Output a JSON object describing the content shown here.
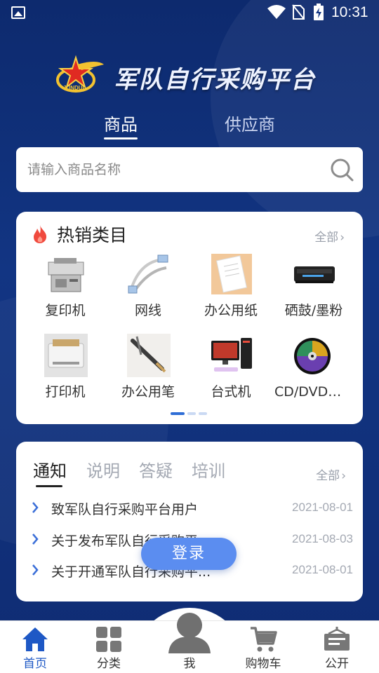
{
  "status_bar": {
    "time": "10:31"
  },
  "header": {
    "app_title": "军队自行采购平台",
    "emblem_text": "JUNDUI"
  },
  "top_tabs": [
    {
      "label": "商品",
      "active": true
    },
    {
      "label": "供应商",
      "active": false
    }
  ],
  "search": {
    "placeholder": "请输入商品名称",
    "value": ""
  },
  "hot_categories": {
    "title": "热销类目",
    "more_label": "全部",
    "items": [
      {
        "label": "复印机",
        "icon": "copier-icon"
      },
      {
        "label": "网线",
        "icon": "network-cable-icon"
      },
      {
        "label": "办公用纸",
        "icon": "paper-icon"
      },
      {
        "label": "硒鼓/墨粉",
        "icon": "toner-icon"
      },
      {
        "label": "打印机",
        "icon": "printer-icon"
      },
      {
        "label": "办公用笔",
        "icon": "pen-icon"
      },
      {
        "label": "台式机",
        "icon": "desktop-icon"
      },
      {
        "label": "CD/DVD刻...",
        "icon": "disc-icon"
      }
    ],
    "page_indicator": {
      "current": 1,
      "total": 3
    }
  },
  "notices": {
    "tabs": [
      {
        "label": "通知",
        "active": true
      },
      {
        "label": "说明",
        "active": false
      },
      {
        "label": "答疑",
        "active": false
      },
      {
        "label": "培训",
        "active": false
      }
    ],
    "more_label": "全部",
    "items": [
      {
        "title": "致军队自行采购平台用户",
        "date": "2021-08-01"
      },
      {
        "title": "关于发布军队自行采购平...",
        "date": "2021-08-03"
      },
      {
        "title": "关于开通军队自行采购平...",
        "date": "2021-08-01"
      }
    ]
  },
  "login_button": {
    "label": "登录"
  },
  "bottom_nav": {
    "home": "首页",
    "category": "分类",
    "me": "我",
    "cart": "购物车",
    "public": "公开"
  },
  "colors": {
    "primary_blue": "#123583",
    "accent_blue": "#5b8df0",
    "flame_red": "#f04a3e"
  }
}
